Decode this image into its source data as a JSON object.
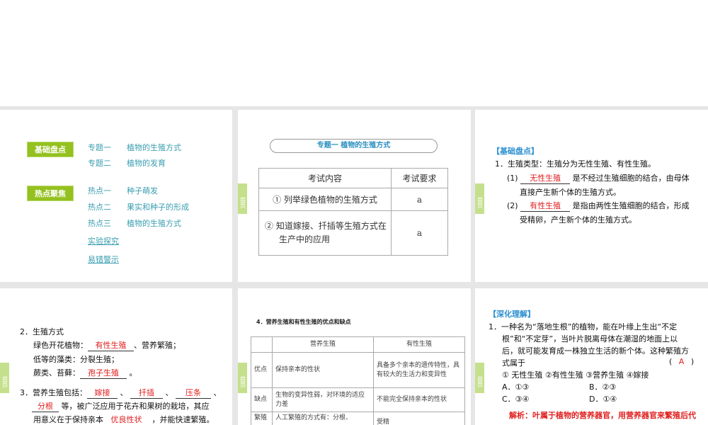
{
  "nav_tab": "首页",
  "slide1": {
    "badges": [
      "基础盘点",
      "热点聚焦"
    ],
    "links": [
      {
        "a": "专题一",
        "b": "植物的生殖方式"
      },
      {
        "a": "专题二",
        "b": "植物的发育"
      },
      {
        "a": "热点一",
        "b": "种子萌发"
      },
      {
        "a": "热点二",
        "b": "果实和种子的形成"
      },
      {
        "a": "热点三",
        "b": "植物的生殖方式"
      },
      {
        "a": "实验探究",
        "b": ""
      },
      {
        "a": "易错警示",
        "b": ""
      }
    ]
  },
  "slide2": {
    "title": "专题一  植物的生殖方式",
    "headers": [
      "考试内容",
      "考试要求"
    ],
    "rows": [
      {
        "content": "① 列举绿色植物的生殖方式",
        "req": "a"
      },
      {
        "content1": "② 知道嫁接、扦插等生殖方式在",
        "content2": "生产中的应用",
        "req": "a"
      }
    ]
  },
  "slide3": {
    "heading": "【基础盘点】",
    "line1": "1．生殖类型：生殖分为无性生殖、有性生殖。",
    "i1_label": "(1)",
    "i1_answer": "无性生殖",
    "i1_text": "是不经过生殖细胞的结合，由母体",
    "i1_text2": "直接产生新个体的生殖方式。",
    "i2_label": "(2)",
    "i2_answer": "有性生殖",
    "i2_text": "是指由两性生殖细胞的结合，形成",
    "i2_text2": "受精卵，产生新个体的生殖方式。"
  },
  "slide4": {
    "title": "2．生殖方式",
    "l1a": "绿色开花植物：",
    "l1ans": "有性生殖",
    "l1b": "、营养繁殖；",
    "l2": "低等的藻类：分裂生殖；",
    "l3a": "蕨类、苔藓：",
    "l3ans": "孢子生殖",
    "l3b": "。",
    "l4a": "3．营养生殖包括：",
    "ans1": "嫁接",
    "ans2": "扦插",
    "ans3": "压条",
    "sep": "、",
    "ans4": "分根",
    "l5b": "等，被广泛应用于花卉和果树的栽培，其应",
    "l6a": "用意义在于保持亲本",
    "ans5": "优良性状",
    "l6b": "，并能快速繁殖。"
  },
  "slide5": {
    "heading": "4．营养生殖和有性生殖的优点和缺点",
    "headers": [
      "",
      "营养生殖",
      "有性生殖"
    ],
    "rows": [
      {
        "label": "优点",
        "veg": "保持亲本的性状",
        "sex": "具备多个亲本的遗传特性，具有较大的生活力和变异性"
      },
      {
        "label": "缺点",
        "veg": "生物的变异性弱，对环境的适应力差",
        "sex": "不能完全保持亲本的性状"
      },
      {
        "label": "繁殖",
        "veg": "人工繁殖的方式有：分根、",
        "sex": "受精"
      }
    ]
  },
  "slide6": {
    "heading": "【深化理解】",
    "q_lines": [
      "1．一种名为“落地生根”的植物，能在叶缘上生出“不定",
      "根”和“不定芽”，当叶片脱离母体在潮湿的地面上以",
      "后，就可能发育成一株独立生活的新个体。这种繁殖方",
      "式属于"
    ],
    "paren_open": "(",
    "answer": "A",
    "paren_close": ")",
    "options_line": "① 无性生殖   ②有性生殖   ③营养生殖   ④嫁接",
    "choices": [
      "A．①③",
      "B．②③",
      "C．③④",
      "D．①④"
    ],
    "analysis": "解析：叶属于植物的营养器官，用营养器官来繁殖后代"
  }
}
